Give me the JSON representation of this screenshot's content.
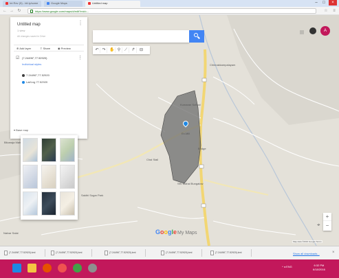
{
  "browser": {
    "tabs": [
      {
        "label": "Int Rev (5) - bit.ly/some"
      },
      {
        "label": "Google Maps"
      },
      {
        "label": "Untitled map"
      }
    ],
    "url": "https://www.google.com/maps/d/edit?mid=..."
  },
  "panel": {
    "title": "Untitled map",
    "subtitle": "1 view",
    "description": "All changes saved in Drive",
    "actions": {
      "add_layer": "Add layer",
      "share": "Share",
      "preview": "Preview"
    },
    "layer": {
      "name": "(7.24496°,77.52920)",
      "style_link": "Individual styles",
      "features": [
        {
          "label": "7.24496°,77.52920",
          "color": "#3c3c3c"
        },
        {
          "label": "Lat/Lng 77.52920",
          "color": "#1e88e5"
        }
      ]
    },
    "base_map": "Base map"
  },
  "map": {
    "labels": {
      "place1": "Chinnakkampalayam",
      "place2": "Kumaran School",
      "place3": "Ex-Mill",
      "place4": "Bridge",
      "place5": "Chai Stall",
      "place6": "SRI Mahal Bungalow",
      "place7": "Bilvaraja Mahal",
      "place8": "Sakthi Sugar Park",
      "place9": "Nalvar Salai"
    },
    "google_logo": {
      "b": "G",
      "o1": "o",
      "o2": "o",
      "g": "g",
      "l": "l",
      "e": "e",
      "suffix": "My Maps"
    },
    "attribution": "Map data ©2016 Google  Terms"
  },
  "downloads": {
    "items": [
      "(7.24496°,77.52920).kml",
      "(7.24496°,77.52920).kml",
      "(7.24496°,77.52920).kml",
      "(7.24496°,77.52920).kml",
      "(7.24496°,77.52920).kml"
    ],
    "show_all": "Show all downloads..."
  },
  "taskbar": {
    "tray": "^  ◂ ENG",
    "time": "6:32 PM",
    "date": "6/18/2016"
  },
  "account": {
    "initial": "A"
  },
  "colors": {
    "accent": "#4285f4",
    "taskbar": "#c2185b",
    "polygon": "#6e6e6e"
  }
}
